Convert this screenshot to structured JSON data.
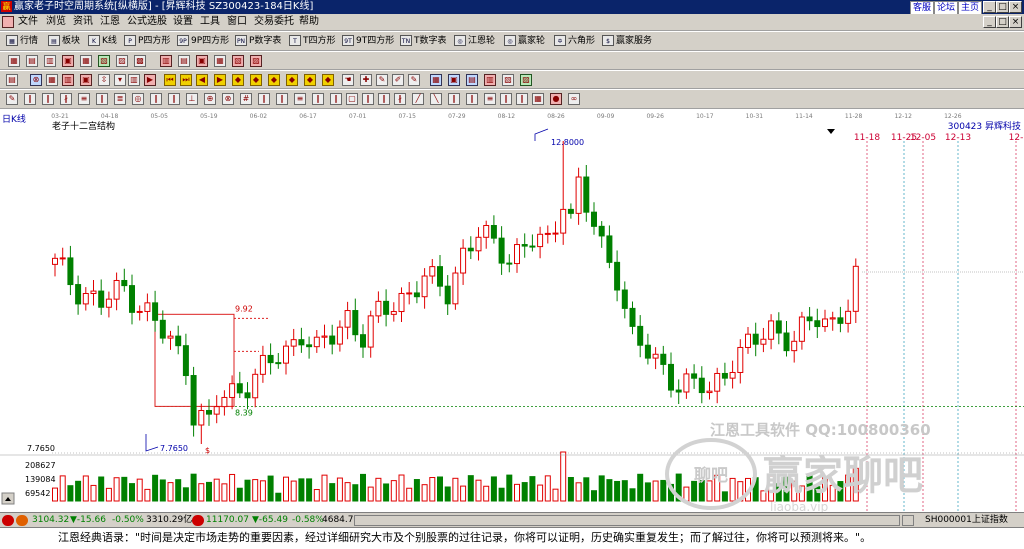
{
  "window": {
    "title": "赢家老子时空周期系统[纵横版] - [昇辉科技  SZ300423-184日K线]",
    "links": [
      "客服",
      "论坛",
      "主页"
    ],
    "controls": [
      "_",
      "□",
      "×"
    ]
  },
  "menu": {
    "items": [
      "文件",
      "浏览",
      "资讯",
      "江恩",
      "公式选股",
      "设置",
      "工具",
      "窗口",
      "交易委托",
      "帮助"
    ],
    "mdi_controls": [
      "_",
      "□",
      "×"
    ]
  },
  "toolbar1": {
    "items": [
      {
        "label": "行情",
        "glyph": "▦"
      },
      {
        "label": "板块",
        "glyph": "▤"
      },
      {
        "label": "K线",
        "glyph": "K"
      },
      {
        "label": "P四方形",
        "glyph": "P"
      },
      {
        "label": "9P四方形",
        "glyph": "9P"
      },
      {
        "label": "P数字表",
        "glyph": "PN"
      },
      {
        "label": "T四方形",
        "glyph": "T"
      },
      {
        "label": "9T四方形",
        "glyph": "9T"
      },
      {
        "label": "T数字表",
        "glyph": "TN"
      },
      {
        "label": "江恩轮",
        "glyph": "◎"
      },
      {
        "label": "赢家轮",
        "glyph": "◎"
      },
      {
        "label": "六角形",
        "glyph": "✡"
      },
      {
        "label": "赢家服务",
        "glyph": "$"
      }
    ]
  },
  "chart": {
    "period_label": "日K线",
    "structure_label": "老子十二宫结构",
    "stock_label": "300423  昇辉科技",
    "colors": {
      "up": "#e00000",
      "down": "#008000",
      "axis_text": "#7a7a7a",
      "projection": "#cc0033",
      "support": "#008000",
      "level": "#0000aa"
    }
  },
  "status": {
    "sh": "3104.32",
    "sh_chg": "▼-15.66",
    "sh_pct": "-0.50%",
    "sh_amt": "3310.29亿",
    "sz": "11170.07",
    "sz_chg": "▼-65.49",
    "sz_pct": "-0.58%",
    "sz_amt": "4684.7",
    "index_code": "SH000001上证指数"
  },
  "quote": "江恩经典语录：\"时间是决定市场走势的重要因素，经过详细研究大市及个别股票的过往记录，你将可以证明，历史确实重复发生；而了解过往，你将可以预测将来。\"。",
  "watermark": {
    "line1": "江恩工具软件   QQ:100800360",
    "logo_text": "赢家聊吧",
    "logo_badge": "聊吧",
    "sub": "liaoba.vip"
  },
  "chart_data": {
    "type": "candlestick",
    "x_ticks": [
      "03-21",
      "04-18",
      "05-05",
      "05-19",
      "06-02",
      "06-17",
      "07-01",
      "07-15",
      "07-29",
      "08-12",
      "08-26",
      "09-09",
      "09-26",
      "10-17",
      "10-31",
      "11-14",
      "11-28",
      "12-12",
      "12-26"
    ],
    "y_labels": [
      "7.7650"
    ],
    "annotations": [
      "12.8000",
      "7.7650",
      "9.92",
      "8.39",
      "$"
    ],
    "projection_dates": [
      "11-18",
      "11-25",
      "12-05",
      "12-13",
      "12-"
    ],
    "volume_labels": [
      "208627",
      "139084",
      "69542"
    ],
    "high": 12.8,
    "low": 7.765,
    "box": {
      "top": 9.92,
      "bottom": 8.39
    },
    "close_path": [
      [
        0,
        10.75
      ],
      [
        3,
        10.35
      ],
      [
        6,
        10.1
      ],
      [
        9,
        10.35
      ],
      [
        12,
        9.95
      ],
      [
        14,
        9.6
      ],
      [
        17,
        9.1
      ],
      [
        18,
        8.3
      ],
      [
        20,
        8.1
      ],
      [
        21,
        8.45
      ],
      [
        24,
        8.7
      ],
      [
        27,
        9.0
      ],
      [
        30,
        9.3
      ],
      [
        32,
        9.65
      ],
      [
        34,
        9.3
      ],
      [
        36,
        9.55
      ],
      [
        38,
        9.9
      ],
      [
        40,
        9.55
      ],
      [
        42,
        9.9
      ],
      [
        45,
        10.2
      ],
      [
        48,
        10.5
      ],
      [
        51,
        10.3
      ],
      [
        53,
        10.95
      ],
      [
        55,
        11.25
      ],
      [
        57,
        11.05
      ],
      [
        59,
        10.9
      ],
      [
        62,
        11.15
      ],
      [
        64,
        11.05
      ],
      [
        65,
        11.4
      ],
      [
        66,
        11.9
      ],
      [
        67,
        11.55
      ],
      [
        68,
        12.1
      ],
      [
        69,
        11.7
      ],
      [
        71,
        11.0
      ],
      [
        73,
        10.6
      ],
      [
        75,
        9.55
      ],
      [
        78,
        9.1
      ],
      [
        81,
        8.8
      ],
      [
        84,
        8.7
      ],
      [
        85,
        8.6
      ],
      [
        86,
        8.8
      ],
      [
        88,
        9.2
      ],
      [
        91,
        9.45
      ],
      [
        93,
        9.7
      ],
      [
        96,
        9.5
      ],
      [
        99,
        9.85
      ],
      [
        101,
        9.8
      ],
      [
        103,
        10.1
      ],
      [
        104,
        10.5
      ]
    ],
    "volume_peaks": [
      [
        66,
        208627
      ],
      [
        104,
        139084
      ]
    ]
  }
}
